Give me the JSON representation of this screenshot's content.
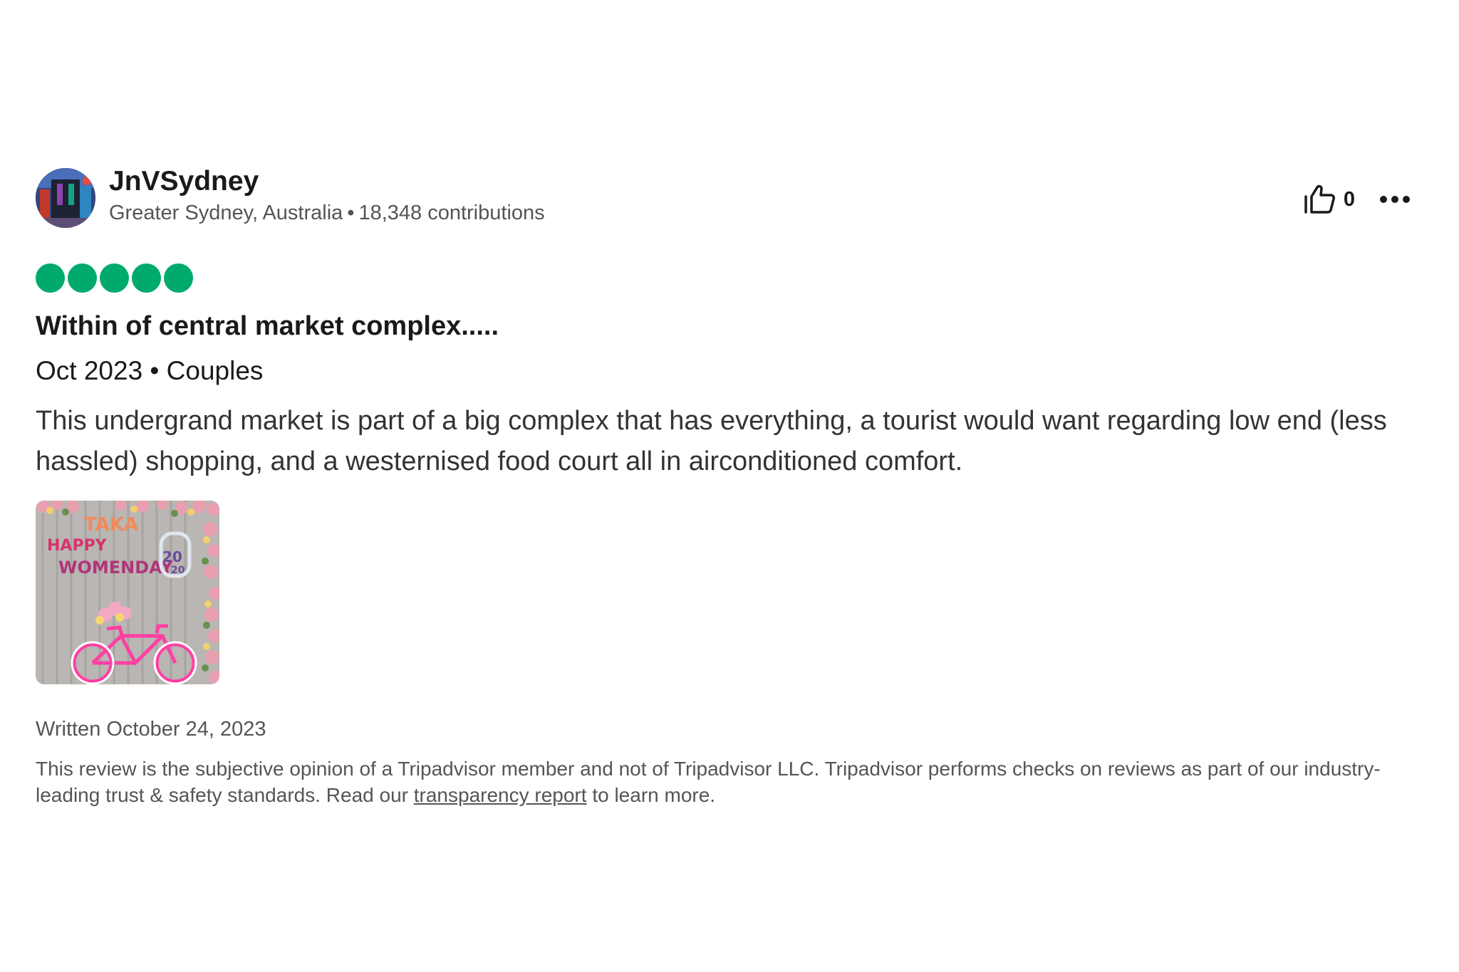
{
  "reviewer": {
    "name": "JnVSydney",
    "location": "Greater Sydney, Australia",
    "separator": "•",
    "contributions": "18,348 contributions"
  },
  "actions": {
    "helpful_count": "0",
    "helpful_icon": "thumbs-up-icon",
    "more_icon": "more-options-icon"
  },
  "rating": {
    "value": 5,
    "max": 5,
    "color": "#00aa6c"
  },
  "review": {
    "title": "Within of central market complex.....",
    "trip_meta": "Oct 2023 • Couples",
    "body": "This undergrand market is part of a big complex that has everything, a tourist would want regarding low end (less hassled) shopping, and a westernised food court all in airconditioned comfort.",
    "photo_signs": {
      "line1": "TAKA",
      "line2": "HAPPY",
      "line3": "WOMENDAY",
      "badge1": "20",
      "badge2": "20"
    },
    "written_date": "Written October 24, 2023"
  },
  "disclaimer": {
    "text_before": "This review is the subjective opinion of a Tripadvisor member and not of Tripadvisor LLC. Tripadvisor performs checks on reviews as part of our industry-leading trust & safety standards. Read our ",
    "link_text": "transparency report",
    "text_after": " to learn more."
  }
}
